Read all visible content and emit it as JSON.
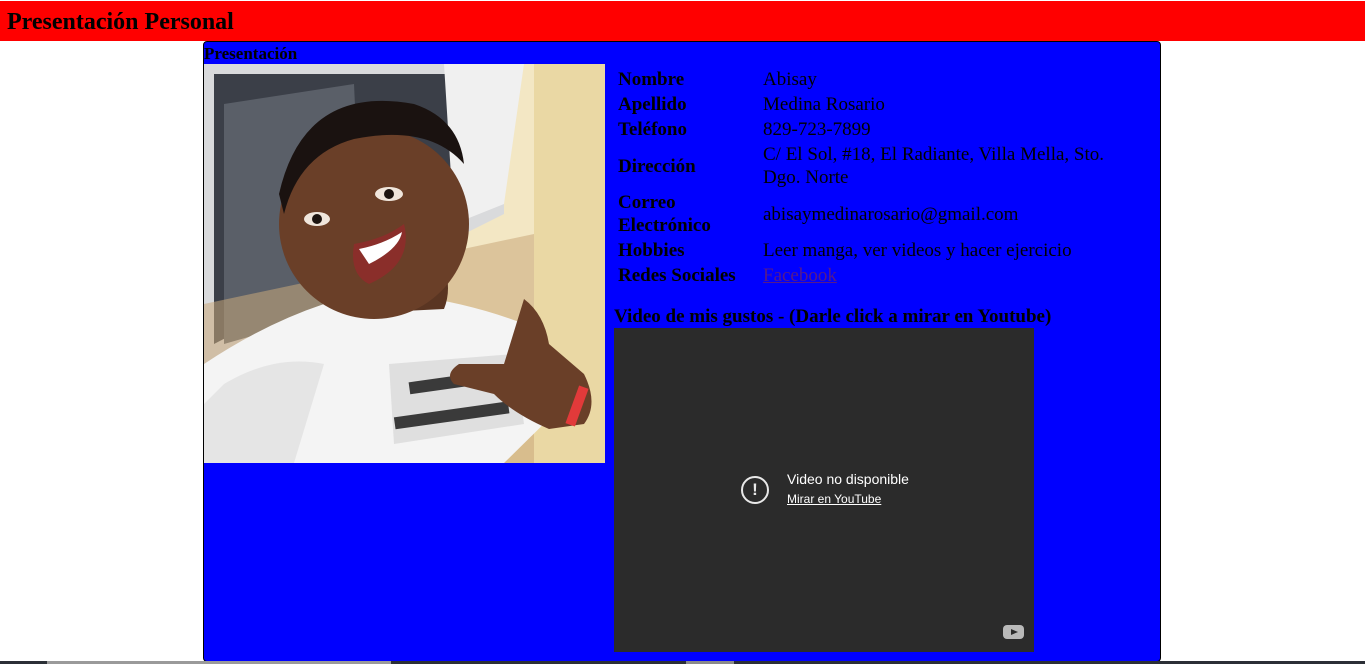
{
  "header": {
    "title": "Presentación Personal"
  },
  "card": {
    "title": "Presentación",
    "photo_alt": "Foto de Abisay"
  },
  "profile": {
    "rows": [
      {
        "label": "Nombre",
        "value": "Abisay"
      },
      {
        "label": "Apellido",
        "value": "Medina Rosario"
      },
      {
        "label": "Teléfono",
        "value": "829-723-7899"
      },
      {
        "label": "Dirección",
        "value": "C/ El Sol, #18, El Radiante, Villa Mella, Sto. Dgo. Norte"
      },
      {
        "label": "Correo Electrónico",
        "value": "abisaymedinarosario@gmail.com"
      },
      {
        "label": "Hobbies",
        "value": "Leer manga, ver videos y hacer ejercicio"
      },
      {
        "label": "Redes Sociales",
        "value": "Facebook"
      }
    ]
  },
  "video": {
    "title": "Video de mis gustos - (Darle click a mirar en Youtube)",
    "message": "Video no disponible",
    "link": "Mirar en YouTube"
  },
  "icons": {
    "warning": "alert-circle-icon",
    "youtube": "youtube-logo-icon"
  },
  "colors": {
    "header_bg": "#ff0000",
    "card_bg": "#0000ff",
    "video_bg": "#2b2b2b",
    "link": "#551a8b"
  }
}
